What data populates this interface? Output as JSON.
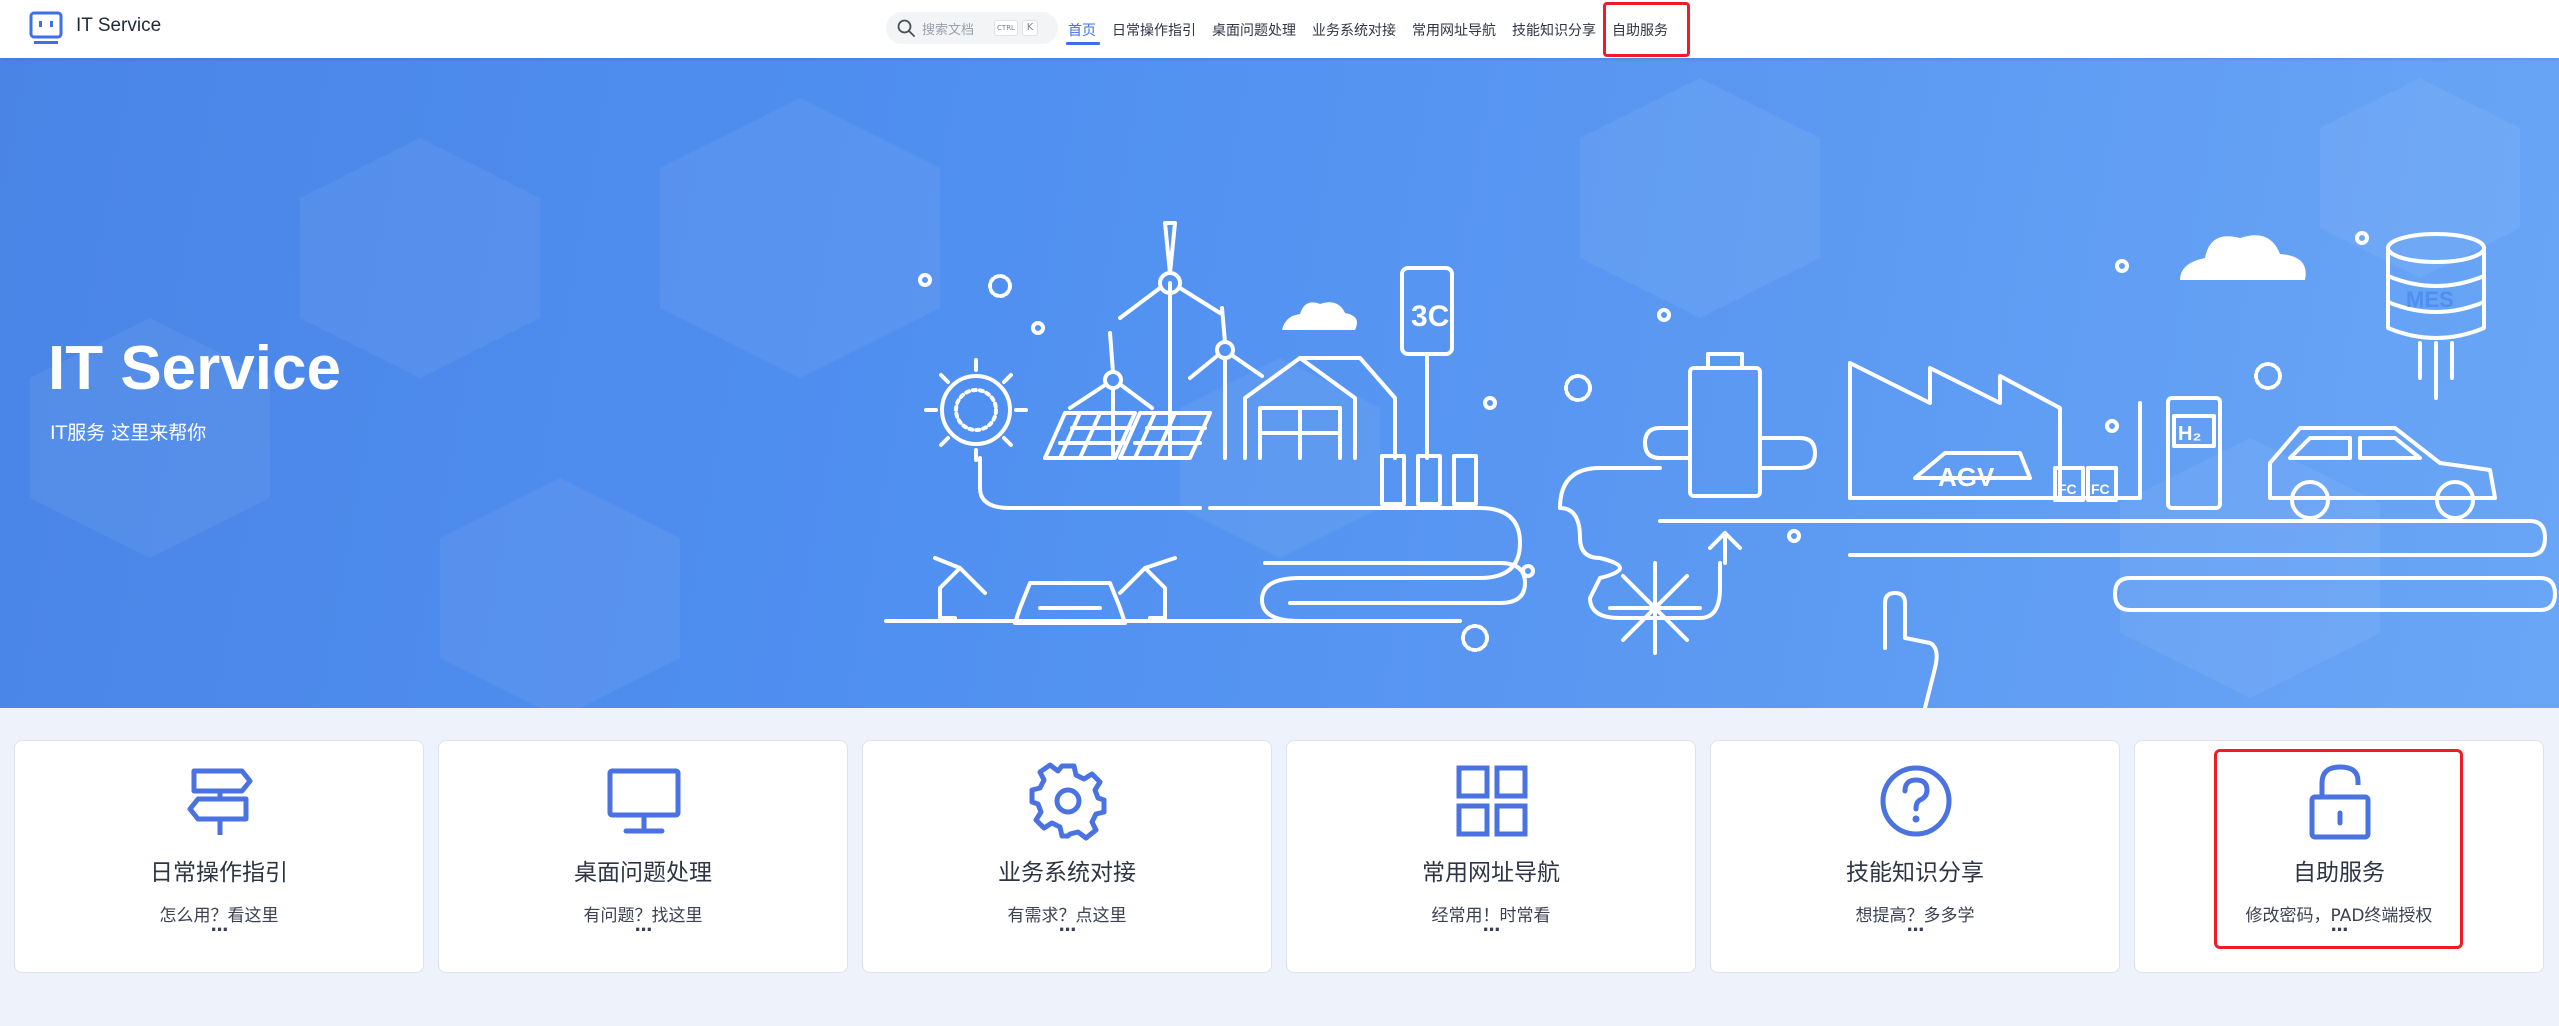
{
  "header": {
    "site_title": "IT Service",
    "logo_icon": "robot-monitor-icon",
    "search": {
      "placeholder": "搜索文档",
      "kbd_ctrl": "CTRL",
      "kbd_key": "K",
      "icon": "search-icon"
    },
    "nav": [
      {
        "label": "首页",
        "active": true
      },
      {
        "label": "日常操作指引",
        "active": false
      },
      {
        "label": "桌面问题处理",
        "active": false
      },
      {
        "label": "业务系统对接",
        "active": false
      },
      {
        "label": "常用网址导航",
        "active": false
      },
      {
        "label": "技能知识分享",
        "active": false
      },
      {
        "label": "自助服务",
        "active": false,
        "highlighted": true
      }
    ]
  },
  "hero": {
    "title": "IT Service",
    "subtitle": "IT服务 这里来帮你",
    "illustration_labels": {
      "phone": "3C",
      "database": "MES",
      "agv": "AGV",
      "hydrogen": "H₂",
      "fuel_cell": "FC"
    }
  },
  "cards": [
    {
      "icon": "signpost-icon",
      "title": "日常操作指引",
      "desc": "怎么用？看这里",
      "more": "..."
    },
    {
      "icon": "monitor-icon",
      "title": "桌面问题处理",
      "desc": "有问题？找这里",
      "more": "..."
    },
    {
      "icon": "gear-icon",
      "title": "业务系统对接",
      "desc": "有需求？点这里",
      "more": "..."
    },
    {
      "icon": "grid-icon",
      "title": "常用网址导航",
      "desc": "经常用！时常看",
      "more": "..."
    },
    {
      "icon": "question-circle-icon",
      "title": "技能知识分享",
      "desc": "想提高？多多学",
      "more": "..."
    },
    {
      "icon": "unlock-icon",
      "title": "自助服务",
      "desc": "修改密码，PAD终端授权",
      "more": "...",
      "highlighted": true
    }
  ],
  "colors": {
    "accent": "#3e6ee8",
    "icon_blue": "#4a72e0",
    "highlight_red": "#ee1c25",
    "hero_start": "#4a85e6",
    "hero_end": "#6aa6f6"
  }
}
